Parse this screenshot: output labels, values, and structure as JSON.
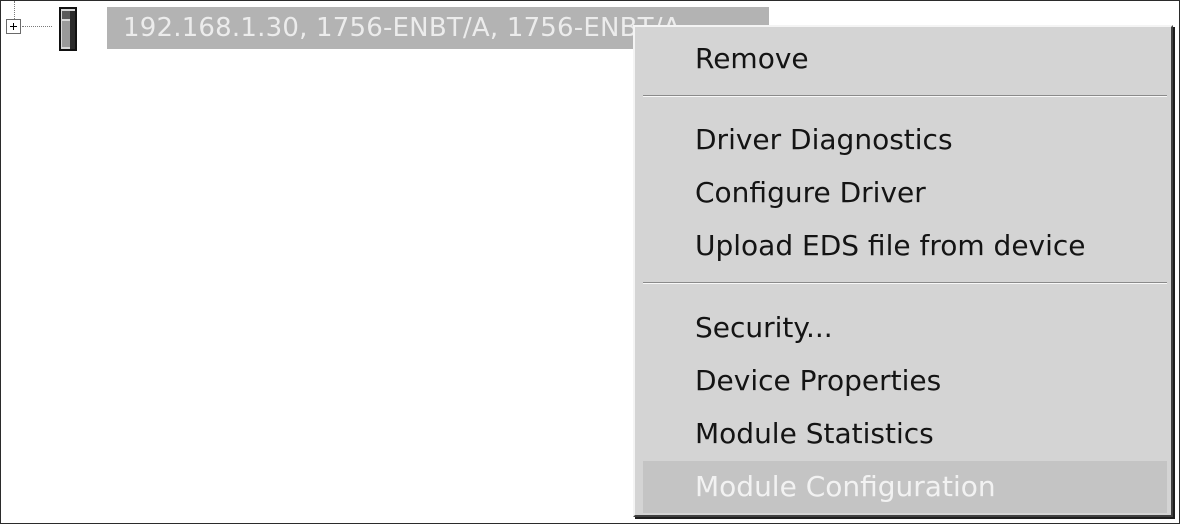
{
  "tree": {
    "expander_symbol": "+",
    "device_icon": "ethernet-module-icon",
    "node_label": "192.168.1.30, 1756-ENBT/A, 1756-ENBT/A"
  },
  "context_menu": {
    "items": [
      {
        "label": "Remove"
      },
      {
        "label": "Driver Diagnostics"
      },
      {
        "label": "Configure Driver"
      },
      {
        "label": "Upload EDS file from device"
      },
      {
        "label": "Security..."
      },
      {
        "label": "Device Properties"
      },
      {
        "label": "Module Statistics"
      },
      {
        "label": "Module Configuration",
        "state": "disabled"
      }
    ]
  },
  "colors": {
    "menu_background": "#d4d4d4",
    "selected_node_background": "#b3b3b3",
    "disabled_text": "#f2f2f2"
  }
}
